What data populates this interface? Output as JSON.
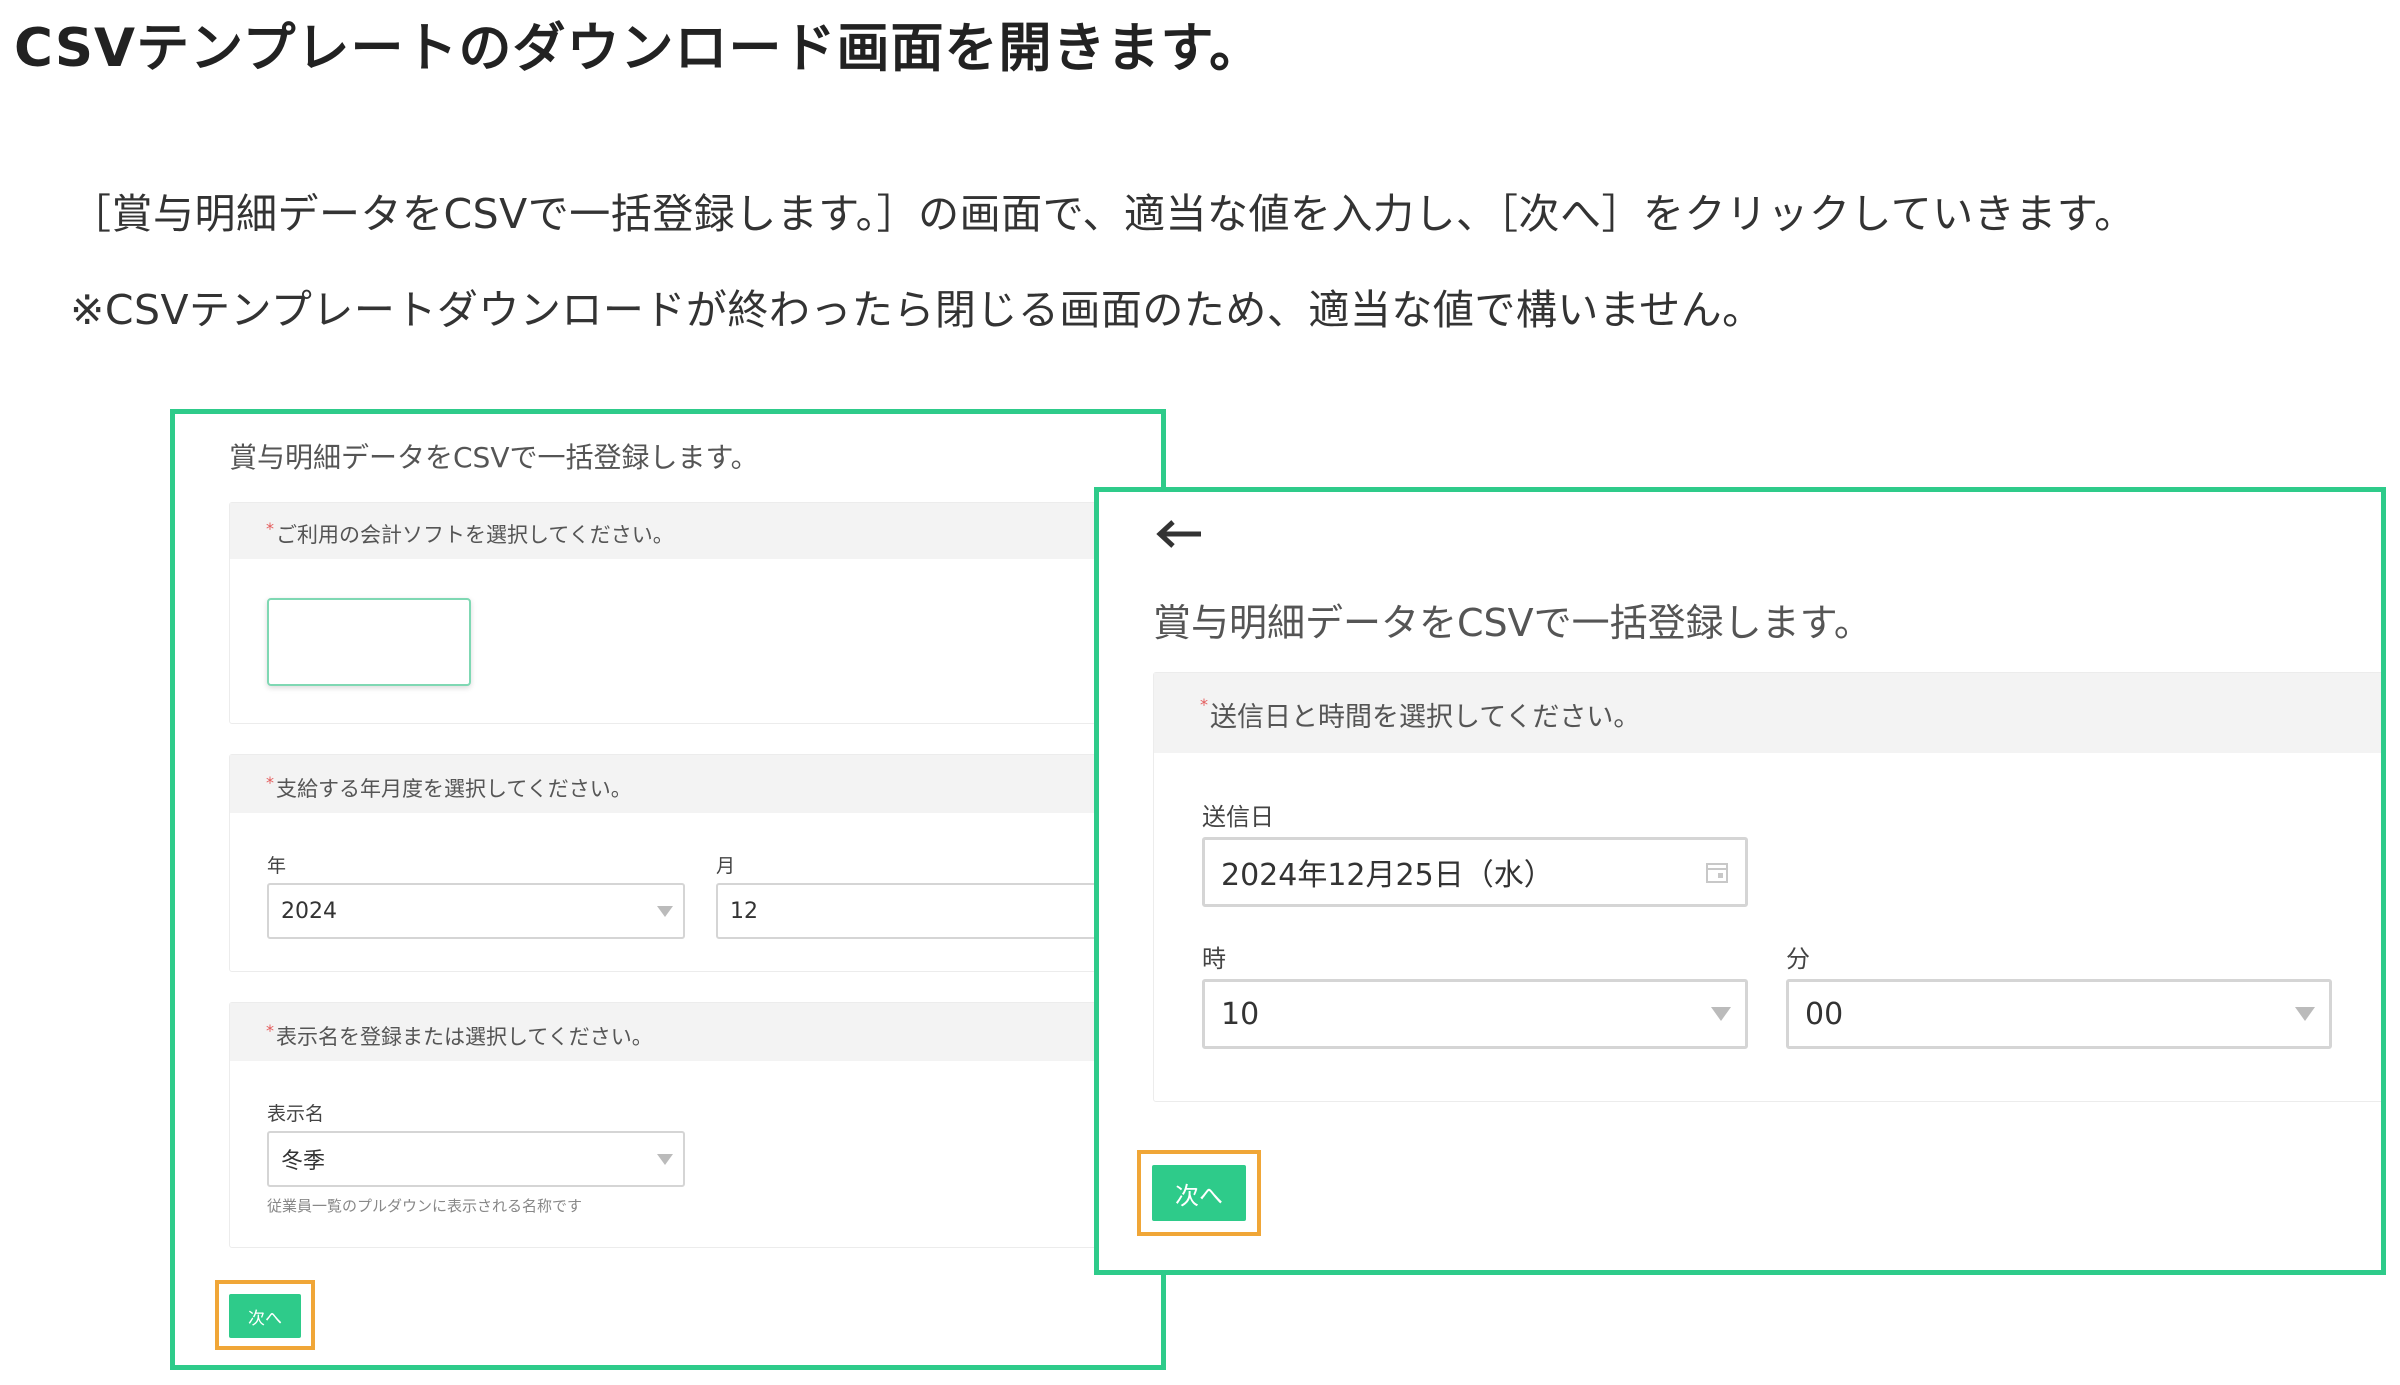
{
  "heading": "CSVテンプレートのダウンロード画面を開きます。",
  "paragraph1": "［賞与明細データをCSVで一括登録します。］の画面で、適当な値を入力し、［次へ］をクリックしていきます。",
  "paragraph2": "※CSVテンプレートダウンロードが終わったら閉じる画面のため、適当な値で構いません。",
  "colors": {
    "panel_border": "#2ecb8a",
    "button": "#2ecb8a",
    "highlight": "#f0a637",
    "required": "#e45a5a"
  },
  "left_panel": {
    "title": "賞与明細データをCSVで一括登録します。",
    "section1": {
      "required_mark": "*",
      "label": "ご利用の会計ソフトを選択してください。"
    },
    "section2": {
      "required_mark": "*",
      "label": "支給する年月度を選択してください。",
      "year_label": "年",
      "year_value": "2024",
      "month_label": "月",
      "month_value": "12"
    },
    "section3": {
      "required_mark": "*",
      "label": "表示名を登録または選択してください。",
      "name_label": "表示名",
      "name_value": "冬季",
      "hint": "従業員一覧のプルダウンに表示される名称です"
    },
    "next_label": "次へ"
  },
  "right_panel": {
    "back_icon": "arrow-left-icon",
    "title": "賞与明細データをCSVで一括登録します。",
    "section": {
      "required_mark": "*",
      "label": "送信日と時間を選択してください。",
      "date_label": "送信日",
      "date_value": "2024年12月25日（水）",
      "hour_label": "時",
      "hour_value": "10",
      "minute_label": "分",
      "minute_value": "00"
    },
    "next_label": "次へ"
  }
}
